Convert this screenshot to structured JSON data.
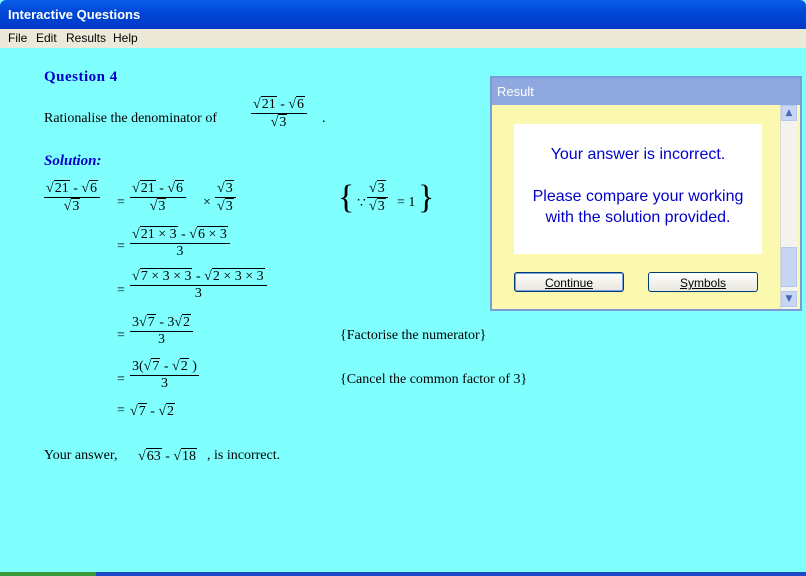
{
  "window": {
    "title": "Interactive Questions"
  },
  "menu": [
    "File",
    "Edit",
    "Results",
    "Help"
  ],
  "question": {
    "heading": "Question 4",
    "prompt": "Rationalise the denominator of",
    "expr_num": "21 - 6",
    "expr_den": "3",
    "period": "."
  },
  "solution": {
    "heading": "Solution:",
    "note_since": "{Factorise the numerator}",
    "note_cancel": "{Cancel the common factor of 3}"
  },
  "answer": {
    "prefix": "Your answer,",
    "suffix": ", is incorrect."
  },
  "dialog": {
    "title": "Result",
    "line1": "Your answer is incorrect.",
    "line2": "Please compare your working",
    "line3": "with the solution provided.",
    "continue_label": "Continue",
    "symbols_label": "Symbols"
  }
}
